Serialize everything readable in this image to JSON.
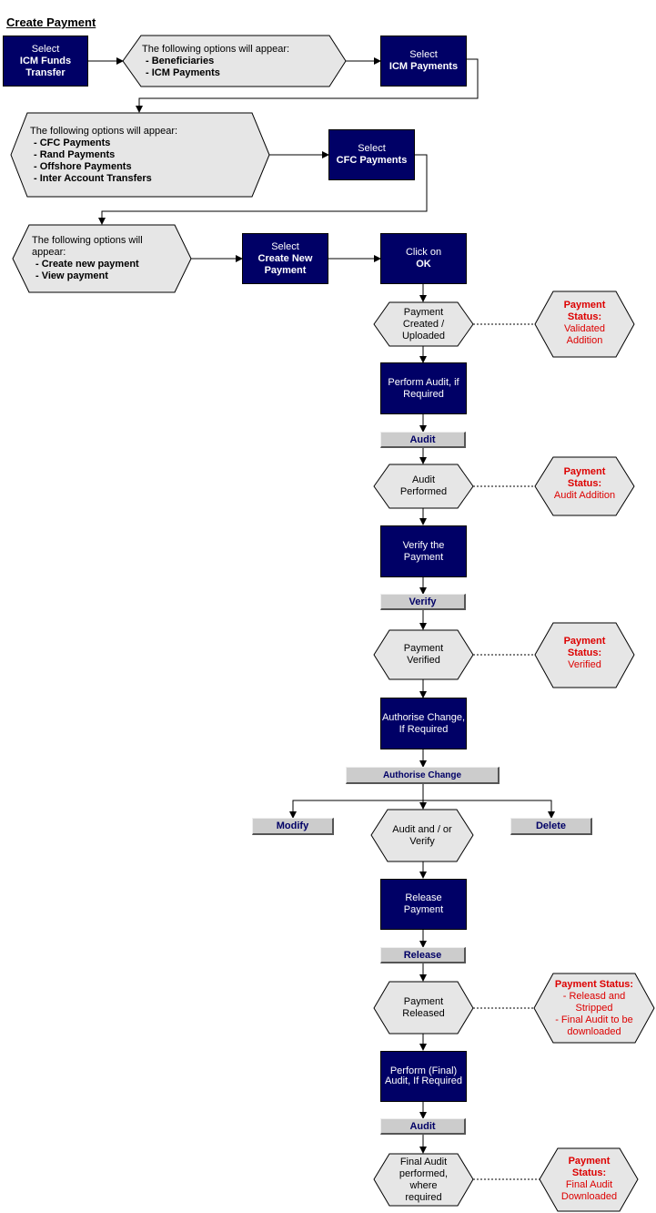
{
  "page": {
    "title": "Create Payment"
  },
  "colors": {
    "process_fill": "#000066",
    "decision_fill": "#e6e6e6",
    "button_fill": "#cccccc",
    "button_text": "#000066",
    "status_text": "#dd0000"
  },
  "steps": {
    "select_icm_funds": {
      "line1": "Select",
      "line2": "ICM Funds",
      "line3": "Transfer"
    },
    "options_1": {
      "intro": "The following options will appear:",
      "items": [
        "- Beneficiaries",
        "- ICM Payments"
      ]
    },
    "select_icm_payments": {
      "line1": "Select",
      "line2": "ICM Payments"
    },
    "options_2": {
      "intro": "The following options will appear:",
      "items": [
        "- CFC Payments",
        "- Rand Payments",
        "- Offshore Payments",
        "- Inter Account Transfers"
      ]
    },
    "select_cfc_payments": {
      "line1": "Select",
      "line2": "CFC Payments"
    },
    "options_3": {
      "intro1": "The following options will",
      "intro2": "appear:",
      "items": [
        "- Create new payment",
        "- View payment"
      ]
    },
    "select_create_new": {
      "line1": "Select",
      "line2": "Create New",
      "line3": "Payment"
    },
    "click_ok": {
      "line1": "Click on",
      "line2": "OK"
    },
    "payment_created": {
      "lines": [
        "Payment",
        "Created /",
        "Uploaded"
      ]
    },
    "perform_audit": {
      "lines": [
        "Perform Audit, if",
        "Required"
      ]
    },
    "audit_button_1": "Audit",
    "audit_performed": {
      "lines": [
        "Audit",
        "Performed"
      ]
    },
    "verify_payment": {
      "lines": [
        "Verify the",
        "Payment"
      ]
    },
    "verify_button": "Verify",
    "payment_verified": {
      "lines": [
        "Payment",
        "Verified"
      ]
    },
    "authorise_change": {
      "lines": [
        "Authorise Change,",
        "If Required"
      ]
    },
    "authorise_button": "Authorise Change",
    "modify_button": "Modify",
    "delete_button": "Delete",
    "audit_or_verify": {
      "lines": [
        "Audit and / or",
        "Verify"
      ]
    },
    "release_payment": {
      "lines": [
        "Release",
        "Payment"
      ]
    },
    "release_button": "Release",
    "payment_released": {
      "lines": [
        "Payment",
        "Released"
      ]
    },
    "final_audit": {
      "lines": [
        "Perform (Final)",
        "Audit, If Required"
      ]
    },
    "audit_button_2": "Audit",
    "final_audit_done": {
      "lines": [
        "Final Audit",
        "performed,",
        "where",
        "required"
      ]
    }
  },
  "statuses": {
    "created": {
      "head": [
        "Payment",
        "Status:"
      ],
      "body": [
        "Validated",
        "Addition"
      ]
    },
    "audited": {
      "head": [
        "Payment",
        "Status:"
      ],
      "body": [
        "Audit Addition"
      ]
    },
    "verified": {
      "head": [
        "Payment",
        "Status:"
      ],
      "body": [
        "Verified"
      ]
    },
    "released": {
      "head": [
        "Payment Status:"
      ],
      "body": [
        "- Releasd and",
        "Stripped",
        "- Final Audit to be",
        "downloaded"
      ]
    },
    "final": {
      "head": [
        "Payment",
        "Status:"
      ],
      "body": [
        "Final Audit",
        "Downloaded"
      ]
    }
  }
}
